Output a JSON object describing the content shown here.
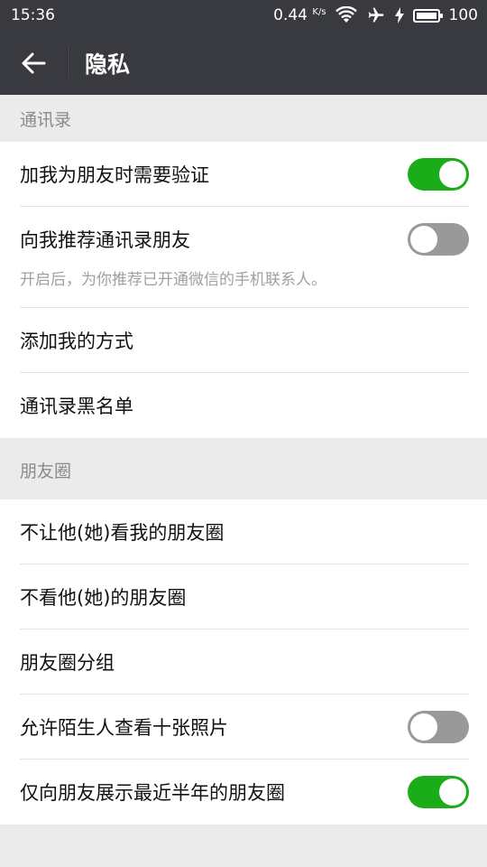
{
  "status": {
    "time": "15:36",
    "speed": "0.44",
    "speed_unit": "K/s",
    "battery": "100"
  },
  "appbar": {
    "title": "隐私"
  },
  "contacts_section": {
    "header": "通讯录",
    "items": [
      {
        "label": "加我为朋友时需要验证",
        "toggle": "on"
      },
      {
        "label": "向我推荐通讯录朋友",
        "toggle": "off",
        "hint": "开启后，为你推荐已开通微信的手机联系人。"
      },
      {
        "label": "添加我的方式"
      },
      {
        "label": "通讯录黑名单"
      }
    ]
  },
  "moments_section": {
    "header": "朋友圈",
    "items": [
      {
        "label": "不让他(她)看我的朋友圈"
      },
      {
        "label": "不看他(她)的朋友圈"
      },
      {
        "label": "朋友圈分组"
      },
      {
        "label": "允许陌生人查看十张照片",
        "toggle": "off"
      },
      {
        "label": "仅向朋友展示最近半年的朋友圈",
        "toggle": "on"
      }
    ]
  },
  "colors": {
    "bar": "#393a3f",
    "toggle_on": "#1aad19",
    "toggle_off": "#999999"
  }
}
